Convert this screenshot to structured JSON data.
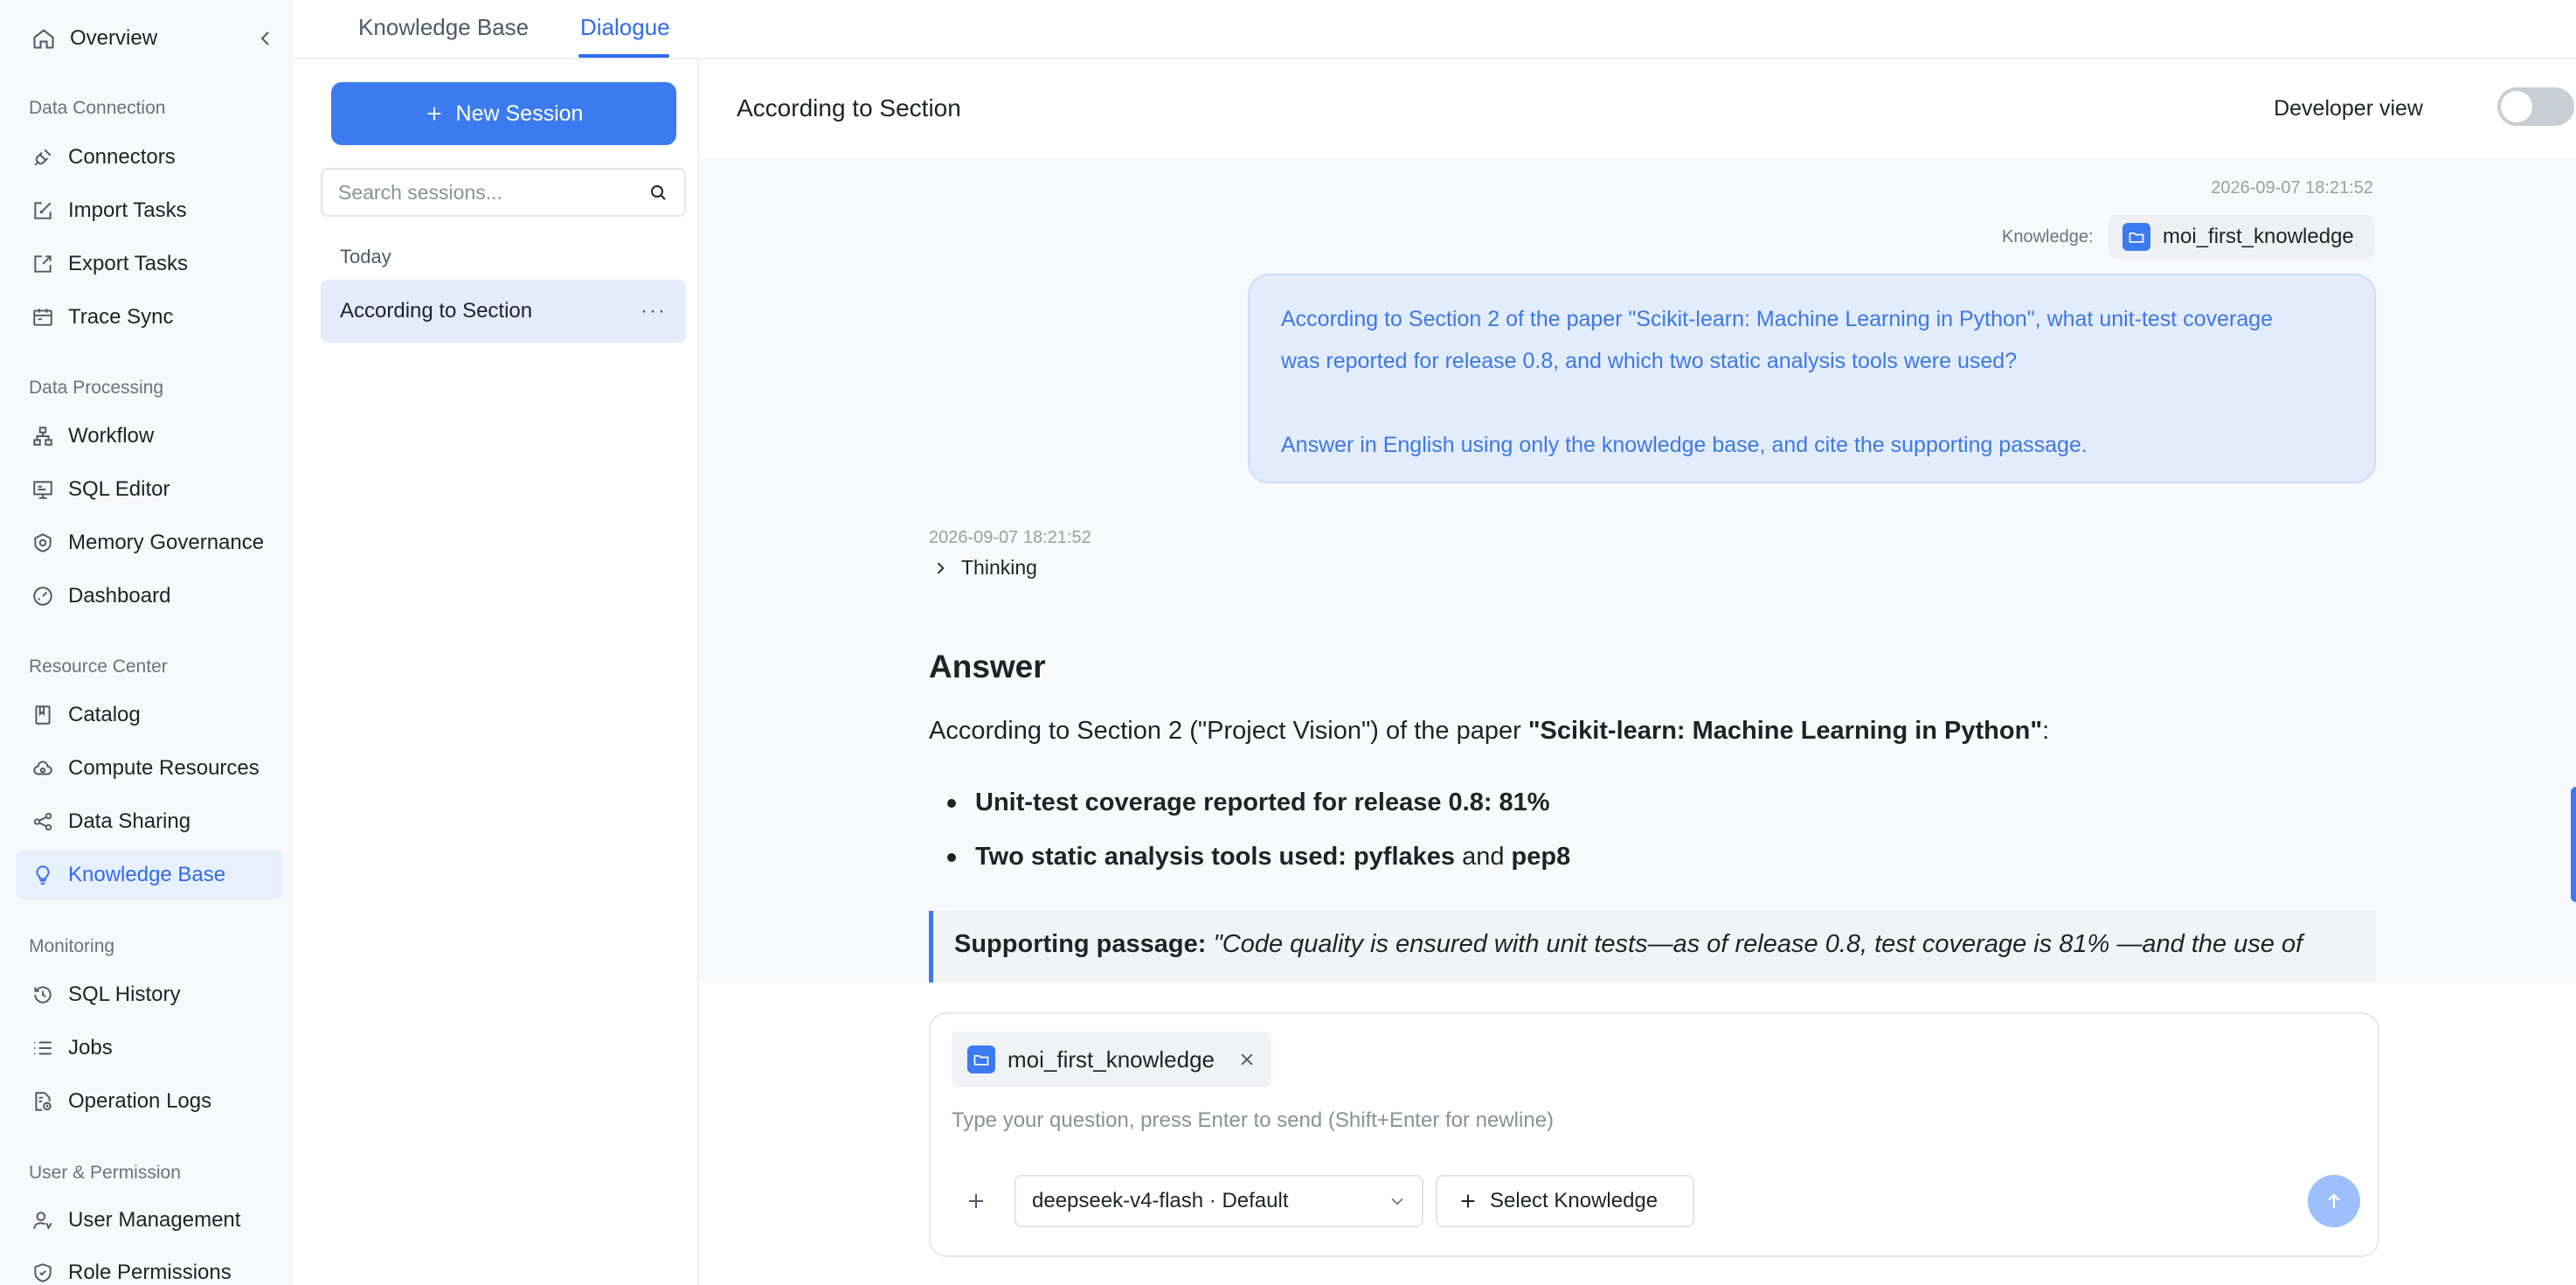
{
  "nav": {
    "overview": "Overview",
    "sections": [
      {
        "title": "Data Connection",
        "items": [
          {
            "label": "Connectors",
            "icon": "plug-icon"
          },
          {
            "label": "Import Tasks",
            "icon": "import-icon"
          },
          {
            "label": "Export Tasks",
            "icon": "export-icon"
          },
          {
            "label": "Trace Sync",
            "icon": "calendar-icon"
          }
        ]
      },
      {
        "title": "Data Processing",
        "items": [
          {
            "label": "Workflow",
            "icon": "workflow-icon"
          },
          {
            "label": "SQL Editor",
            "icon": "monitor-icon"
          },
          {
            "label": "Memory Governance",
            "icon": "brain-icon"
          },
          {
            "label": "Dashboard",
            "icon": "gauge-icon"
          }
        ]
      },
      {
        "title": "Resource Center",
        "items": [
          {
            "label": "Catalog",
            "icon": "book-icon"
          },
          {
            "label": "Compute Resources",
            "icon": "cloud-icon"
          },
          {
            "label": "Data Sharing",
            "icon": "share-icon"
          },
          {
            "label": "Knowledge Base",
            "icon": "bulb-icon",
            "active": true
          }
        ]
      },
      {
        "title": "Monitoring",
        "items": [
          {
            "label": "SQL History",
            "icon": "history-icon"
          },
          {
            "label": "Jobs",
            "icon": "list-icon"
          },
          {
            "label": "Operation Logs",
            "icon": "log-icon"
          }
        ]
      },
      {
        "title": "User & Permission",
        "items": [
          {
            "label": "User Management",
            "icon": "user-icon"
          },
          {
            "label": "Role Permissions",
            "icon": "shield-icon"
          }
        ]
      }
    ]
  },
  "tabs": {
    "knowledge_base": "Knowledge Base",
    "dialogue": "Dialogue",
    "active": "Dialogue"
  },
  "sessions": {
    "new_label": "New Session",
    "search_placeholder": "Search sessions...",
    "group": "Today",
    "items": [
      {
        "title": "According to Section",
        "more": "···"
      }
    ]
  },
  "chat": {
    "title": "According to Section",
    "developer_view_label": "Developer view",
    "developer_view_on": false,
    "user_message": {
      "timestamp": "2026-09-07 18:21:52",
      "knowledge_label": "Knowledge:",
      "knowledge_name": "moi_first_knowledge",
      "line1": "According to Section 2 of the paper \"Scikit-learn: Machine Learning in Python\", what unit-test coverage",
      "line2": "was reported for release 0.8, and which two static analysis tools were used?",
      "line3": "Answer in English using only the knowledge base, and cite the supporting passage."
    },
    "assistant": {
      "timestamp": "2026-09-07 18:21:52",
      "thinking_label": "Thinking",
      "answer_heading": "Answer",
      "intro_prefix": "According to Section 2 (\"Project Vision\") of the paper ",
      "intro_bold": "\"Scikit-learn: Machine Learning in Python\"",
      "intro_suffix": ":",
      "bullet1_bold": "Unit-test coverage reported for release 0.8: 81%",
      "bullet2_bold_a": "Two static analysis tools used: pyflakes",
      "bullet2_mid": " and ",
      "bullet2_bold_b": "pep8",
      "quote_label": "Supporting passage:",
      "quote_text": "\"Code quality is ensured with unit tests—as of release 0.8, test coverage is 81% —and the use of"
    }
  },
  "composer": {
    "attached_knowledge": "moi_first_knowledge",
    "placeholder": "Type your question, press Enter to send (Shift+Enter for newline)",
    "model": "deepseek-v4-flash · Default",
    "select_knowledge_label": "Select Knowledge"
  },
  "colors": {
    "accent": "#3b7af0",
    "active_bg": "#e8f0fe",
    "bubble_bg": "#e3ecfd"
  }
}
